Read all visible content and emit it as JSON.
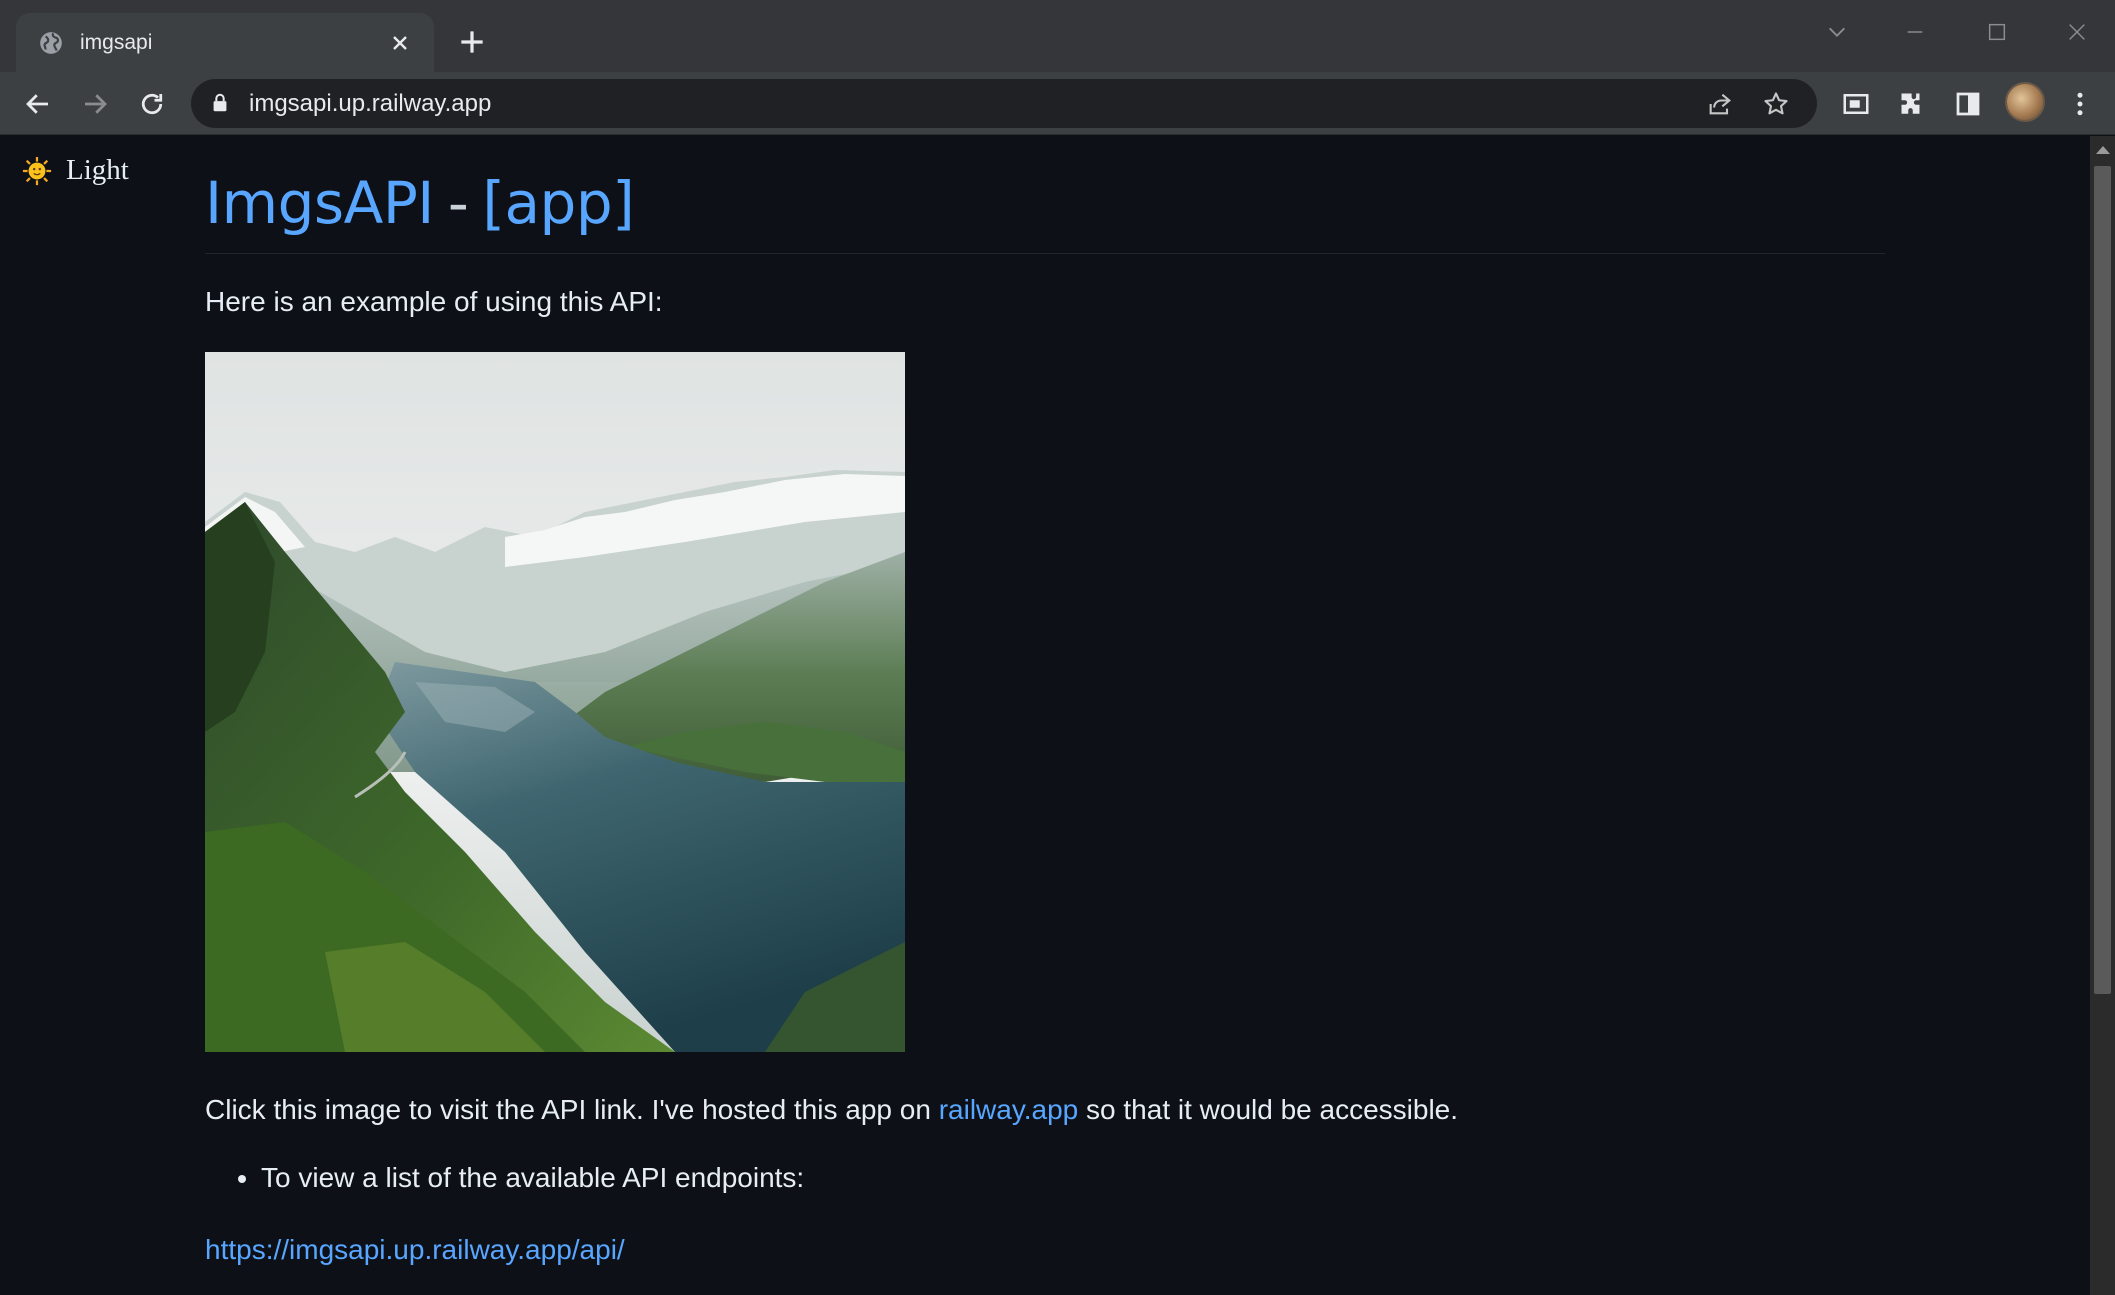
{
  "browser": {
    "tab_title": "imgsapi",
    "url": "imgsapi.up.railway.app"
  },
  "page": {
    "theme_toggle_label": "Light",
    "title_main": "ImgsAPI",
    "title_separator": "-",
    "title_app": "[app]",
    "intro": "Here is an example of using this API:",
    "image_alt": "Fjord landscape with misty mountains",
    "desc_before": "Click this image to visit the API link. I've hosted this app on ",
    "desc_link": "railway.app",
    "desc_after": " so that it would be accessible.",
    "list_items": [
      "To view a list of the available API endpoints:"
    ],
    "api_link": "https://imgsapi.up.railway.app/api/"
  },
  "colors": {
    "page_bg": "#0d1117",
    "link": "#58a6ff",
    "text": "#e6edf3",
    "chrome_bg": "#35363a",
    "toolbar_bg": "#3c4043"
  }
}
